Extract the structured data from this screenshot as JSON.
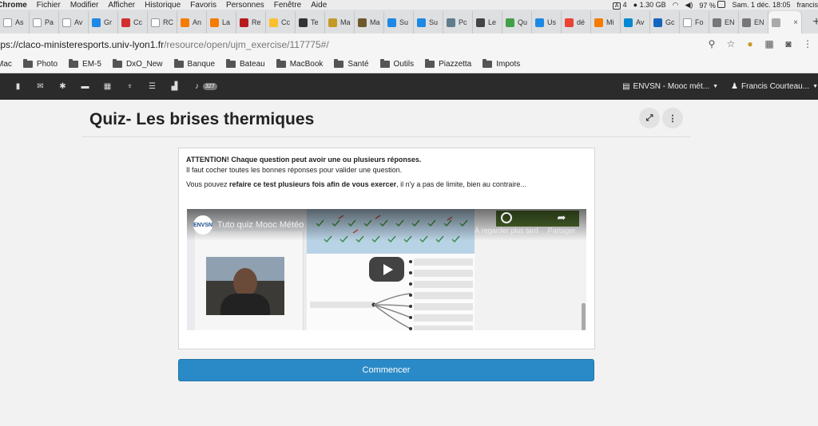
{
  "menubar": {
    "app": "Chrome",
    "items": [
      "Fichier",
      "Modifier",
      "Afficher",
      "Historique",
      "Favoris",
      "Personnes",
      "Fenêtre",
      "Aide"
    ],
    "status": {
      "count": "4",
      "memory": "1.30 GB",
      "battery": "97 %",
      "datetime": "Sam. 1 déc.  18:05",
      "user": "francis"
    }
  },
  "tabs": [
    {
      "label": "As",
      "color": "#ffffff"
    },
    {
      "label": "Pa",
      "color": "#ffffff"
    },
    {
      "label": "Av",
      "color": "#ffffff"
    },
    {
      "label": "Gr",
      "color": "#1e88e5"
    },
    {
      "label": "Cc",
      "color": "#d32f2f"
    },
    {
      "label": "RC",
      "color": "#ffffff"
    },
    {
      "label": "An",
      "color": "#f57c00"
    },
    {
      "label": "La",
      "color": "#f57c00"
    },
    {
      "label": "Re",
      "color": "#b71c1c"
    },
    {
      "label": "Cc",
      "color": "#fbc02d"
    },
    {
      "label": "Te",
      "color": "#333333"
    },
    {
      "label": "Ma",
      "color": "#c49a27"
    },
    {
      "label": "Ma",
      "color": "#6d5a2c"
    },
    {
      "label": "Su",
      "color": "#1e88e5"
    },
    {
      "label": "Su",
      "color": "#1e88e5"
    },
    {
      "label": "Pc",
      "color": "#607d8b"
    },
    {
      "label": "Le",
      "color": "#444444"
    },
    {
      "label": "Qu",
      "color": "#43a047"
    },
    {
      "label": "Us",
      "color": "#1e88e5"
    },
    {
      "label": "dé",
      "color": "#ea4335"
    },
    {
      "label": "Mi",
      "color": "#f57c00"
    },
    {
      "label": "Av",
      "color": "#0288d1"
    },
    {
      "label": "Gc",
      "color": "#1565c0"
    },
    {
      "label": "Fo",
      "color": "#ffffff"
    },
    {
      "label": "EN",
      "color": "#777777"
    },
    {
      "label": "EN",
      "color": "#777777"
    }
  ],
  "active_tab": {
    "close": "×"
  },
  "address": {
    "url_main": "tps://claco-ministeresports.univ-lyon1.fr",
    "url_path": "/resource/open/ujm_exercise/117775#/"
  },
  "bookmarks": [
    "Mac",
    "Photo",
    "EM-5",
    "DxO_New",
    "Banque",
    "Bateau",
    "MacBook",
    "Santé",
    "Outils",
    "Piazzetta",
    "Impots"
  ],
  "appnav": {
    "notifications": "327",
    "workspace": "ENVSN - Mooc mét...",
    "user": "Francis Courteau..."
  },
  "page": {
    "title": "Quiz- Les brises thermiques",
    "attention": "ATTENTION! Chaque question peut avoir une ou plusieurs réponses.",
    "subtext": "Il faut cocher toutes les bonnes réponses pour valider une question.",
    "retry_pre": "Vous pouvez ",
    "retry_bold": "refaire ce test plusieurs fois afin de vous exercer",
    "retry_post": ", il n'y a pas de limite, bien au contraire...",
    "start_button": "Commencer"
  },
  "video": {
    "title": "Tuto quiz Mooc Météo",
    "logo": "ENVSN",
    "watch_later": "À regarder plus tard",
    "share": "Partager"
  }
}
